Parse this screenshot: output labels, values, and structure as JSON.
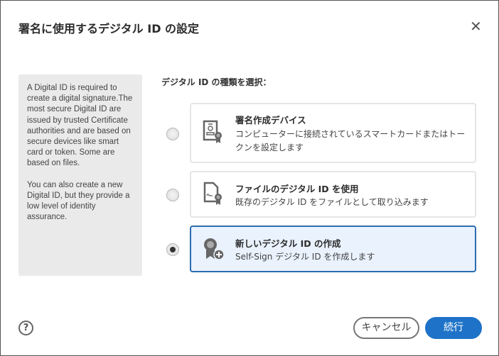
{
  "dialog": {
    "title": "署名に使用するデジタル ID の設定"
  },
  "info": {
    "paragraph1": "A Digital ID is required to create a digital signature.The most secure Digital ID are issued by trusted Certificate authorities and are based on secure devices like smart card or token. Some are based on files.",
    "paragraph2": "You can also create a new Digital ID, but they provide a low level of identity assurance."
  },
  "prompt": "デジタル ID の種類を選択：",
  "options": [
    {
      "title": "署名作成デバイス",
      "desc": "コンピューターに接続されているスマートカードまたはトークンを設定します",
      "icon": "certificate-person-icon",
      "selected": false
    },
    {
      "title": "ファイルのデジタル ID を使用",
      "desc": "既存のデジタル ID をファイルとして取り込みます",
      "icon": "file-signature-icon",
      "selected": false
    },
    {
      "title": "新しいデジタル ID の作成",
      "desc": "Self-Sign デジタル ID を作成します",
      "icon": "badge-add-icon",
      "selected": true
    }
  ],
  "footer": {
    "help": "?",
    "cancel": "キャンセル",
    "continue": "続行"
  },
  "colors": {
    "accent": "#1e73c8",
    "selected_bg": "#e9f2fd"
  }
}
